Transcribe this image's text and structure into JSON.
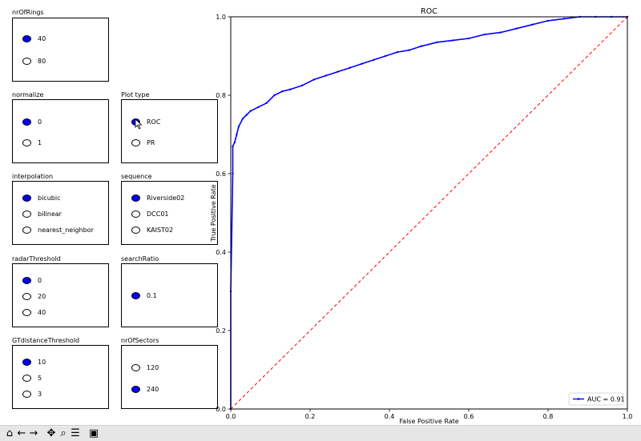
{
  "panels": [
    {
      "id": "nrOfRings",
      "title": "nrOfRings",
      "options": [
        "40",
        "80"
      ],
      "selected": 0
    },
    {
      "id": "normalize",
      "title": "normalize",
      "options": [
        "0",
        "1"
      ],
      "selected": 0
    },
    {
      "id": "plotType",
      "title": "Plot type",
      "options": [
        "ROC",
        "PR"
      ],
      "selected": 0
    },
    {
      "id": "interpolation",
      "title": "interpolation",
      "options": [
        "bicubic",
        "bilinear",
        "nearest_neighbor"
      ],
      "selected": 0
    },
    {
      "id": "sequence",
      "title": "sequence",
      "options": [
        "Riverside02",
        "DCC01",
        "KAIST02"
      ],
      "selected": 0
    },
    {
      "id": "radarThreshold",
      "title": "radarThreshold",
      "options": [
        "0",
        "20",
        "40"
      ],
      "selected": 0
    },
    {
      "id": "searchRatio",
      "title": "searchRatio",
      "options": [
        "0.1"
      ],
      "selected": 0
    },
    {
      "id": "gtDistanceThreshold",
      "title": "GTdistanceThreshold",
      "options": [
        "10",
        "5",
        "3"
      ],
      "selected": 0
    },
    {
      "id": "nrOfSectors",
      "title": "nrOfSectors",
      "options": [
        "120",
        "240"
      ],
      "selected": 1
    }
  ],
  "toolbar": {
    "buttons": [
      {
        "name": "home-icon",
        "glyph": "⌂"
      },
      {
        "name": "back-icon",
        "glyph": "←"
      },
      {
        "name": "forward-icon",
        "glyph": "→"
      },
      {
        "name": "pan-icon",
        "glyph": "✥"
      },
      {
        "name": "zoom-icon",
        "glyph": "⌕"
      },
      {
        "name": "configure-subplots-icon",
        "glyph": "☰"
      },
      {
        "name": "save-icon",
        "glyph": "▣"
      }
    ]
  },
  "colors": {
    "series": "#0000ff",
    "diagonal": "#ff0000",
    "selected_radio": "#0000ff"
  },
  "chart_data": {
    "type": "line",
    "title": "ROC",
    "xlabel": "False Positive Rate",
    "ylabel": "True Positive Rate",
    "xlim": [
      0.0,
      1.0
    ],
    "ylim": [
      0.0,
      1.0
    ],
    "xticks": [
      "0.0",
      "0.2",
      "0.4",
      "0.6",
      "0.8",
      "1.0"
    ],
    "yticks": [
      "0.0",
      "0.2",
      "0.4",
      "0.6",
      "0.8",
      "1.0"
    ],
    "grid": false,
    "legend_position": "bottom-right",
    "series": [
      {
        "name": "AUC = 0.91",
        "color": "#0000ff",
        "marker": "dot",
        "x": [
          0.0,
          0.0,
          0.005,
          0.005,
          0.01,
          0.015,
          0.02,
          0.03,
          0.04,
          0.05,
          0.07,
          0.09,
          0.11,
          0.13,
          0.15,
          0.18,
          0.21,
          0.24,
          0.27,
          0.3,
          0.33,
          0.36,
          0.39,
          0.42,
          0.45,
          0.48,
          0.52,
          0.56,
          0.6,
          0.64,
          0.68,
          0.72,
          0.76,
          0.8,
          0.84,
          0.88,
          0.92,
          0.96,
          1.0
        ],
        "y": [
          0.0,
          0.3,
          0.6,
          0.67,
          0.68,
          0.7,
          0.72,
          0.74,
          0.75,
          0.76,
          0.77,
          0.78,
          0.8,
          0.81,
          0.815,
          0.825,
          0.84,
          0.85,
          0.86,
          0.87,
          0.88,
          0.89,
          0.9,
          0.91,
          0.915,
          0.925,
          0.935,
          0.94,
          0.945,
          0.955,
          0.96,
          0.97,
          0.98,
          0.99,
          0.995,
          1.0,
          1.0,
          1.0,
          1.0
        ]
      },
      {
        "name": "",
        "color": "#ff0000",
        "style": "dashed",
        "x": [
          0.0,
          1.0
        ],
        "y": [
          0.0,
          1.0
        ]
      }
    ]
  }
}
